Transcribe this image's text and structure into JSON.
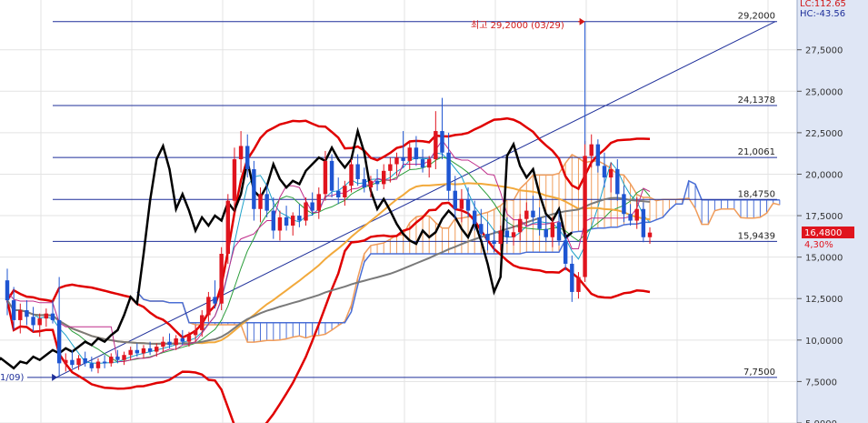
{
  "header": {
    "lc": "LC:112.65",
    "hc": "HC:-43.56"
  },
  "colors": {
    "axis_bg": "#dfe6f5",
    "grid": "#e3e3e3",
    "level": "#1e2f9a",
    "up": "#e0141e",
    "down": "#1e55d2",
    "bollinger": "#e00000",
    "black_line": "#000000",
    "ichimoku_fill": "#4a6fd6",
    "ichimoku_warm": "#f09c5a",
    "price_tag_bg": "#e0141e"
  },
  "annotations": {
    "high_label": "최고 29,2000 (03/29)",
    "low_label": "1/09)",
    "current_price": "16,4800",
    "current_change": "4,30%"
  },
  "chart_data": {
    "type": "line",
    "subtype": "candlestick",
    "title": "",
    "xlabel": "",
    "ylabel": "",
    "ylim": [
      5.0,
      30.5
    ],
    "yticks": [
      "27,5000",
      "25,0000",
      "22,5000",
      "20,0000",
      "17,5000",
      "15,0000",
      "12,5000",
      "10,0000",
      "7,5000",
      "5,0000"
    ],
    "ytick_values": [
      27.5,
      25.0,
      22.5,
      20.0,
      17.5,
      15.0,
      12.5,
      10.0,
      7.5,
      5.0
    ],
    "levels": [
      {
        "label": "29,2000",
        "value": 29.2
      },
      {
        "label": "24,1378",
        "value": 24.1378
      },
      {
        "label": "21,0061",
        "value": 21.0061
      },
      {
        "label": "18,4750",
        "value": 18.475
      },
      {
        "label": "15,9439",
        "value": 15.9439
      },
      {
        "label": "7,7500",
        "value": 7.75
      }
    ],
    "candles": [
      [
        13.6,
        14.3,
        11.5,
        12.4
      ],
      [
        12.4,
        13.2,
        10.6,
        11.2
      ],
      [
        11.2,
        12.2,
        10.4,
        11.8
      ],
      [
        11.8,
        12.4,
        10.9,
        11.4
      ],
      [
        11.4,
        12.0,
        10.5,
        10.9
      ],
      [
        10.9,
        11.6,
        10.2,
        11.3
      ],
      [
        11.3,
        11.9,
        10.8,
        11.6
      ],
      [
        11.6,
        12.4,
        11.0,
        11.2
      ],
      [
        11.2,
        13.8,
        7.8,
        8.6
      ],
      [
        8.6,
        9.2,
        8.1,
        8.8
      ],
      [
        8.8,
        9.4,
        8.3,
        8.5
      ],
      [
        8.5,
        9.1,
        8.2,
        8.9
      ],
      [
        8.9,
        9.3,
        8.4,
        8.6
      ],
      [
        8.6,
        9.0,
        8.1,
        8.3
      ],
      [
        8.3,
        8.9,
        8.0,
        8.7
      ],
      [
        8.7,
        9.1,
        8.3,
        8.6
      ],
      [
        8.6,
        9.2,
        8.4,
        9.0
      ],
      [
        9.0,
        9.4,
        8.6,
        8.8
      ],
      [
        8.8,
        9.3,
        8.5,
        9.1
      ],
      [
        9.1,
        9.6,
        8.8,
        9.4
      ],
      [
        9.4,
        9.8,
        9.0,
        9.2
      ],
      [
        9.2,
        9.7,
        8.9,
        9.5
      ],
      [
        9.5,
        9.9,
        9.1,
        9.3
      ],
      [
        9.3,
        9.8,
        9.0,
        9.6
      ],
      [
        9.6,
        10.2,
        9.3,
        9.9
      ],
      [
        9.9,
        10.4,
        9.5,
        9.7
      ],
      [
        9.7,
        10.3,
        9.4,
        10.1
      ],
      [
        10.1,
        10.6,
        9.7,
        9.9
      ],
      [
        9.9,
        10.5,
        9.6,
        10.3
      ],
      [
        10.3,
        10.9,
        9.9,
        10.6
      ],
      [
        10.6,
        11.8,
        10.2,
        11.5
      ],
      [
        11.5,
        12.9,
        11.1,
        12.6
      ],
      [
        12.6,
        13.6,
        11.9,
        12.2
      ],
      [
        12.2,
        15.6,
        11.8,
        15.2
      ],
      [
        15.2,
        18.8,
        14.6,
        18.4
      ],
      [
        18.4,
        21.6,
        17.6,
        20.9
      ],
      [
        20.9,
        22.6,
        20.1,
        21.7
      ],
      [
        21.7,
        22.4,
        19.8,
        20.3
      ],
      [
        20.3,
        20.8,
        17.2,
        17.9
      ],
      [
        17.9,
        19.2,
        17.1,
        18.8
      ],
      [
        18.8,
        19.4,
        17.4,
        17.8
      ],
      [
        17.8,
        18.6,
        16.1,
        16.6
      ],
      [
        16.6,
        17.8,
        16.0,
        17.4
      ],
      [
        17.4,
        18.1,
        16.6,
        16.9
      ],
      [
        16.9,
        17.7,
        16.3,
        17.5
      ],
      [
        17.5,
        18.2,
        16.8,
        17.2
      ],
      [
        17.2,
        18.6,
        16.9,
        18.3
      ],
      [
        18.3,
        18.9,
        17.5,
        17.8
      ],
      [
        17.8,
        19.2,
        17.3,
        18.8
      ],
      [
        18.8,
        21.4,
        18.4,
        20.8
      ],
      [
        20.8,
        21.2,
        18.6,
        19.0
      ],
      [
        19.0,
        19.8,
        18.2,
        18.6
      ],
      [
        18.6,
        19.6,
        18.1,
        19.3
      ],
      [
        19.3,
        20.9,
        18.9,
        20.6
      ],
      [
        20.6,
        21.2,
        19.3,
        19.7
      ],
      [
        19.7,
        20.4,
        18.9,
        19.2
      ],
      [
        19.2,
        19.9,
        18.6,
        19.6
      ],
      [
        19.6,
        20.3,
        19.0,
        19.4
      ],
      [
        19.4,
        20.6,
        19.1,
        20.2
      ],
      [
        20.2,
        21.0,
        19.5,
        20.6
      ],
      [
        20.6,
        21.3,
        19.9,
        21.0
      ],
      [
        21.0,
        22.6,
        20.4,
        20.8
      ],
      [
        20.8,
        22.0,
        20.3,
        21.6
      ],
      [
        21.6,
        22.3,
        20.5,
        20.9
      ],
      [
        20.9,
        21.5,
        20.1,
        20.4
      ],
      [
        20.4,
        21.1,
        19.8,
        20.9
      ],
      [
        20.9,
        23.8,
        20.3,
        22.6
      ],
      [
        22.6,
        24.6,
        20.9,
        21.3
      ],
      [
        21.3,
        22.5,
        18.4,
        19.0
      ],
      [
        19.0,
        19.9,
        17.3,
        17.9
      ],
      [
        17.9,
        19.1,
        17.1,
        18.5
      ],
      [
        18.5,
        19.2,
        17.4,
        17.8
      ],
      [
        17.8,
        18.4,
        16.6,
        17.0
      ],
      [
        17.0,
        17.9,
        16.1,
        16.4
      ],
      [
        16.4,
        17.1,
        15.4,
        16.0
      ],
      [
        16.0,
        16.6,
        15.3,
        15.8
      ],
      [
        15.8,
        16.9,
        15.4,
        16.6
      ],
      [
        16.6,
        17.4,
        15.8,
        16.2
      ],
      [
        16.2,
        16.9,
        15.7,
        16.5
      ],
      [
        16.5,
        17.6,
        16.0,
        17.3
      ],
      [
        17.3,
        18.3,
        16.9,
        17.8
      ],
      [
        17.8,
        18.7,
        17.1,
        17.4
      ],
      [
        17.4,
        18.0,
        16.3,
        16.7
      ],
      [
        16.7,
        17.5,
        15.9,
        16.2
      ],
      [
        16.2,
        17.4,
        15.6,
        17.1
      ],
      [
        17.1,
        17.8,
        15.7,
        16.0
      ],
      [
        16.0,
        16.4,
        14.2,
        14.6
      ],
      [
        14.6,
        15.1,
        12.3,
        12.9
      ],
      [
        12.9,
        14.1,
        12.5,
        13.8
      ],
      [
        13.8,
        22.0,
        13.5,
        21.1
      ],
      [
        21.1,
        22.4,
        20.4,
        21.8
      ],
      [
        21.8,
        22.1,
        20.1,
        20.5
      ],
      [
        20.5,
        21.3,
        19.2,
        19.8
      ],
      [
        19.8,
        20.7,
        18.9,
        20.3
      ],
      [
        20.3,
        20.9,
        18.4,
        18.8
      ],
      [
        18.8,
        19.3,
        17.1,
        17.6
      ],
      [
        17.6,
        18.2,
        16.9,
        17.2
      ],
      [
        17.2,
        18.6,
        16.7,
        17.9
      ],
      [
        17.9,
        18.3,
        15.9,
        16.2
      ],
      [
        16.2,
        16.8,
        15.8,
        16.48
      ]
    ]
  }
}
